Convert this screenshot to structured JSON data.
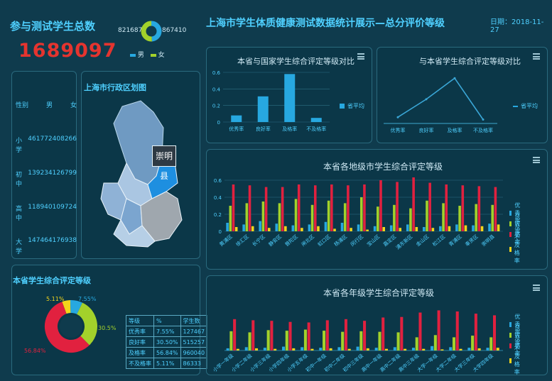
{
  "header": {
    "total_label": "参与测试学生总数",
    "total_value": "1689097",
    "male_count": "821687",
    "female_count": "867410",
    "gender_legend": [
      "男",
      "女"
    ],
    "main_title": "上海市学生体质健康测试数据统计展示—总分评价等级",
    "date": "日期：2018-11-27"
  },
  "stats": {
    "headers": [
      "性别",
      "男",
      "女"
    ],
    "rows": [
      {
        "level": "小学",
        "male": "461772",
        "female": "408266"
      },
      {
        "level": "初中",
        "male": "139234",
        "female": "126799"
      },
      {
        "level": "高中",
        "male": "118940",
        "female": "109724"
      },
      {
        "level": "大学",
        "male": "147464",
        "female": "176938"
      }
    ]
  },
  "map": {
    "title": "上海市行政区划图",
    "callout": "崇明县"
  },
  "grade_panel": {
    "title": "本省学生综合评定等级",
    "donut_labels": [
      "5.11%",
      "7.55%",
      "30.5%",
      "56.84%"
    ],
    "table": [
      [
        "等级",
        "%",
        "学生数"
      ],
      [
        "优秀率",
        "7.55%",
        "127467"
      ],
      [
        "良好率",
        "30.50%",
        "515257"
      ],
      [
        "及格率",
        "56.84%",
        "960040"
      ],
      [
        "不及格率",
        "5.11%",
        "86333"
      ]
    ]
  },
  "top_left_chart": {
    "title": "本省与国家学生综合评定等级对比",
    "legend": "省平均"
  },
  "top_right_chart": {
    "title": "与本省学生综合评定等级对比",
    "legend": "省平均"
  },
  "city_chart": {
    "title": "本省各地级市学生综合评定等级",
    "legend": [
      "优秀率",
      "良好率",
      "及格率",
      "不及格率"
    ]
  },
  "grade_chart": {
    "title": "本省各年级学生综合评定等级",
    "legend": [
      "优秀率",
      "良好率",
      "及格率",
      "不及格率"
    ]
  },
  "chart_data": [
    {
      "type": "bar",
      "categories": [
        "优秀率",
        "良好率",
        "及格率",
        "不及格率"
      ],
      "series": [
        {
          "name": "省平均",
          "values": [
            0.08,
            0.31,
            0.58,
            0.05
          ]
        }
      ],
      "ylim": [
        0,
        0.6
      ],
      "yticks": [
        "0",
        "0.2",
        "0.4",
        "0.6"
      ]
    },
    {
      "type": "line",
      "categories": [
        "优秀率",
        "良好率",
        "及格率",
        "不及格率"
      ],
      "series": [
        {
          "name": "省平均",
          "values": [
            0.08,
            0.31,
            0.58,
            0.05
          ]
        }
      ]
    },
    {
      "type": "pie",
      "categories": [
        "不及格率",
        "优秀率",
        "良好率",
        "及格率"
      ],
      "values": [
        5.11,
        7.55,
        30.5,
        56.84
      ]
    },
    {
      "type": "bar",
      "categories": [
        "黄浦区",
        "徐汇区",
        "长宁区",
        "静安区",
        "普陀区",
        "闸北区",
        "虹口区",
        "杨浦区",
        "闵行区",
        "宝山区",
        "嘉定区",
        "浦东新区",
        "金山区",
        "松江区",
        "青浦区",
        "奉贤区",
        "崇明县"
      ],
      "ylim": [
        0,
        0.6
      ],
      "yticks": [
        "0",
        "0.2",
        "0.4",
        "0.6"
      ],
      "series": [
        {
          "name": "优秀率",
          "values": [
            0.1,
            0.08,
            0.12,
            0.09,
            0.07,
            0.08,
            0.11,
            0.1,
            0.08,
            0.06,
            0.07,
            0.08,
            0.05,
            0.06,
            0.08,
            0.07,
            0.09
          ]
        },
        {
          "name": "良好率",
          "values": [
            0.3,
            0.33,
            0.35,
            0.33,
            0.38,
            0.31,
            0.36,
            0.33,
            0.4,
            0.29,
            0.31,
            0.27,
            0.36,
            0.33,
            0.3,
            0.32,
            0.31
          ]
        },
        {
          "name": "及格率",
          "values": [
            0.55,
            0.54,
            0.52,
            0.52,
            0.55,
            0.54,
            0.55,
            0.54,
            0.55,
            0.6,
            0.58,
            0.64,
            0.57,
            0.55,
            0.54,
            0.53,
            0.52
          ]
        },
        {
          "name": "不及格率",
          "values": [
            0.05,
            0.06,
            0.04,
            0.06,
            0.04,
            0.06,
            0.03,
            0.04,
            0.02,
            0.05,
            0.04,
            0.05,
            0.04,
            0.06,
            0.07,
            0.06,
            0.08
          ]
        }
      ]
    },
    {
      "type": "bar",
      "categories": [
        "小学一年级",
        "小学二年级",
        "小学三年级",
        "小学四年级",
        "小学五年级",
        "初中一年级",
        "初中二年级",
        "初中三年级",
        "高中一年级",
        "高中二年级",
        "高中三年级",
        "大学一年级",
        "大学二年级",
        "大学三年级",
        "大学四年级"
      ],
      "ylim": [
        0,
        0.8
      ],
      "series": [
        {
          "name": "优秀率",
          "values": [
            0.04,
            0.06,
            0.05,
            0.07,
            0.06,
            0.05,
            0.06,
            0.07,
            0.05,
            0.06,
            0.05,
            0.08,
            0.06,
            0.05,
            0.05
          ]
        },
        {
          "name": "良好率",
          "values": [
            0.35,
            0.33,
            0.37,
            0.36,
            0.38,
            0.36,
            0.34,
            0.35,
            0.34,
            0.33,
            0.24,
            0.28,
            0.24,
            0.27,
            0.24
          ]
        },
        {
          "name": "及格率",
          "values": [
            0.57,
            0.55,
            0.54,
            0.52,
            0.51,
            0.55,
            0.57,
            0.54,
            0.6,
            0.61,
            0.69,
            0.73,
            0.71,
            0.67,
            0.64
          ]
        },
        {
          "name": "不及格率",
          "values": [
            0.03,
            0.04,
            0.03,
            0.04,
            0.03,
            0.04,
            0.03,
            0.04,
            0.03,
            0.03,
            0.03,
            0.02,
            0.03,
            0.04,
            0.05
          ]
        }
      ]
    }
  ],
  "colors": {
    "excellent": "#27a8e0",
    "good": "#a3d12b",
    "pass": "#e1213f",
    "fail": "#f3d51b",
    "accent": "#4fd0ff"
  }
}
